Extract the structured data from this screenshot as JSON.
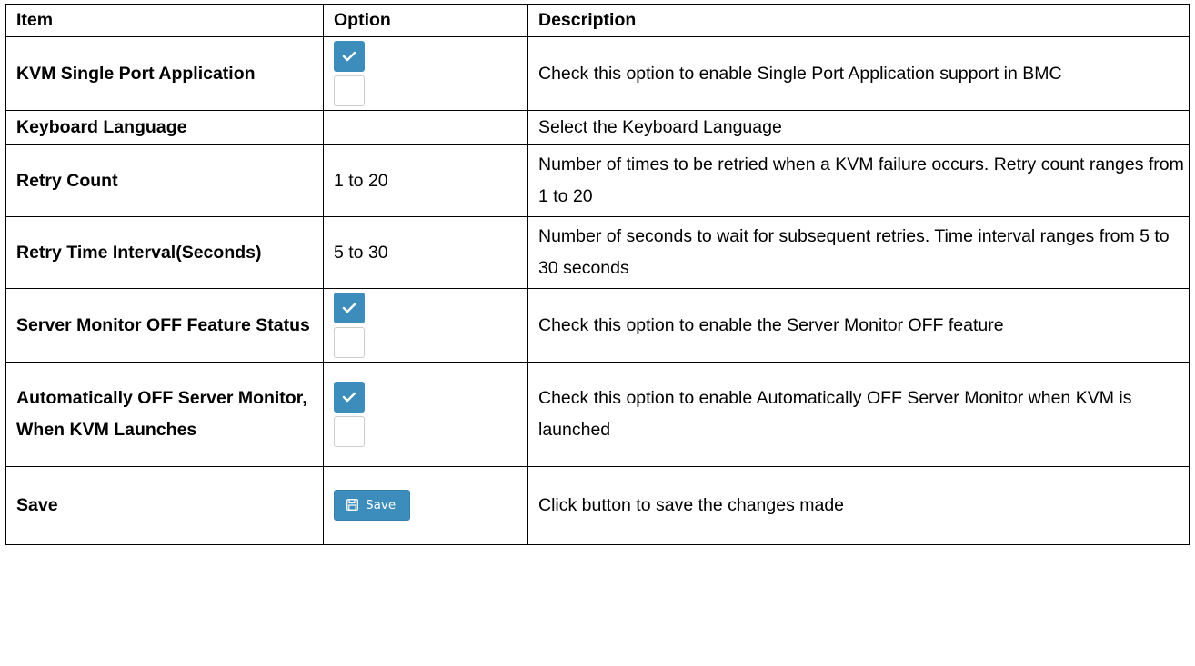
{
  "table": {
    "headers": {
      "item": "Item",
      "option": "Option",
      "description": "Description"
    },
    "rows": [
      {
        "item": "KVM Single Port Application",
        "option_type": "checkbox-pair",
        "checkbox_states": [
          true,
          false
        ],
        "description": "Check this option to enable Single Port Application support in BMC"
      },
      {
        "item": "Keyboard Language",
        "option_type": "empty",
        "option": "",
        "description": "Select the Keyboard Language"
      },
      {
        "item": "Retry Count",
        "option_type": "text",
        "option": "1 to 20",
        "description": "Number of times to be retried when a KVM failure occurs. Retry count ranges from 1 to 20"
      },
      {
        "item": "Retry Time Interval(Seconds)",
        "option_type": "text",
        "option": "5 to 30",
        "description": "Number of seconds to wait for subsequent retries. Time interval ranges from 5 to 30 seconds"
      },
      {
        "item": "Server Monitor OFF Feature Status",
        "option_type": "checkbox-pair",
        "checkbox_states": [
          true,
          false
        ],
        "description": "Check this option to enable the Server Monitor OFF feature"
      },
      {
        "item": "Automatically OFF Server Monitor, When KVM Launches",
        "option_type": "checkbox-pair",
        "checkbox_states": [
          true,
          false
        ],
        "description": "Check this option to enable Automatically OFF Server Monitor when KVM is launched"
      },
      {
        "item": "Save",
        "option_type": "button",
        "button_label": "Save",
        "button_icon": "save-icon",
        "description": "Click button to save the changes made"
      }
    ]
  },
  "colors": {
    "accent": "#3c8dbc",
    "checkbox_border": "#cccccc",
    "grid_line": "#000000"
  }
}
